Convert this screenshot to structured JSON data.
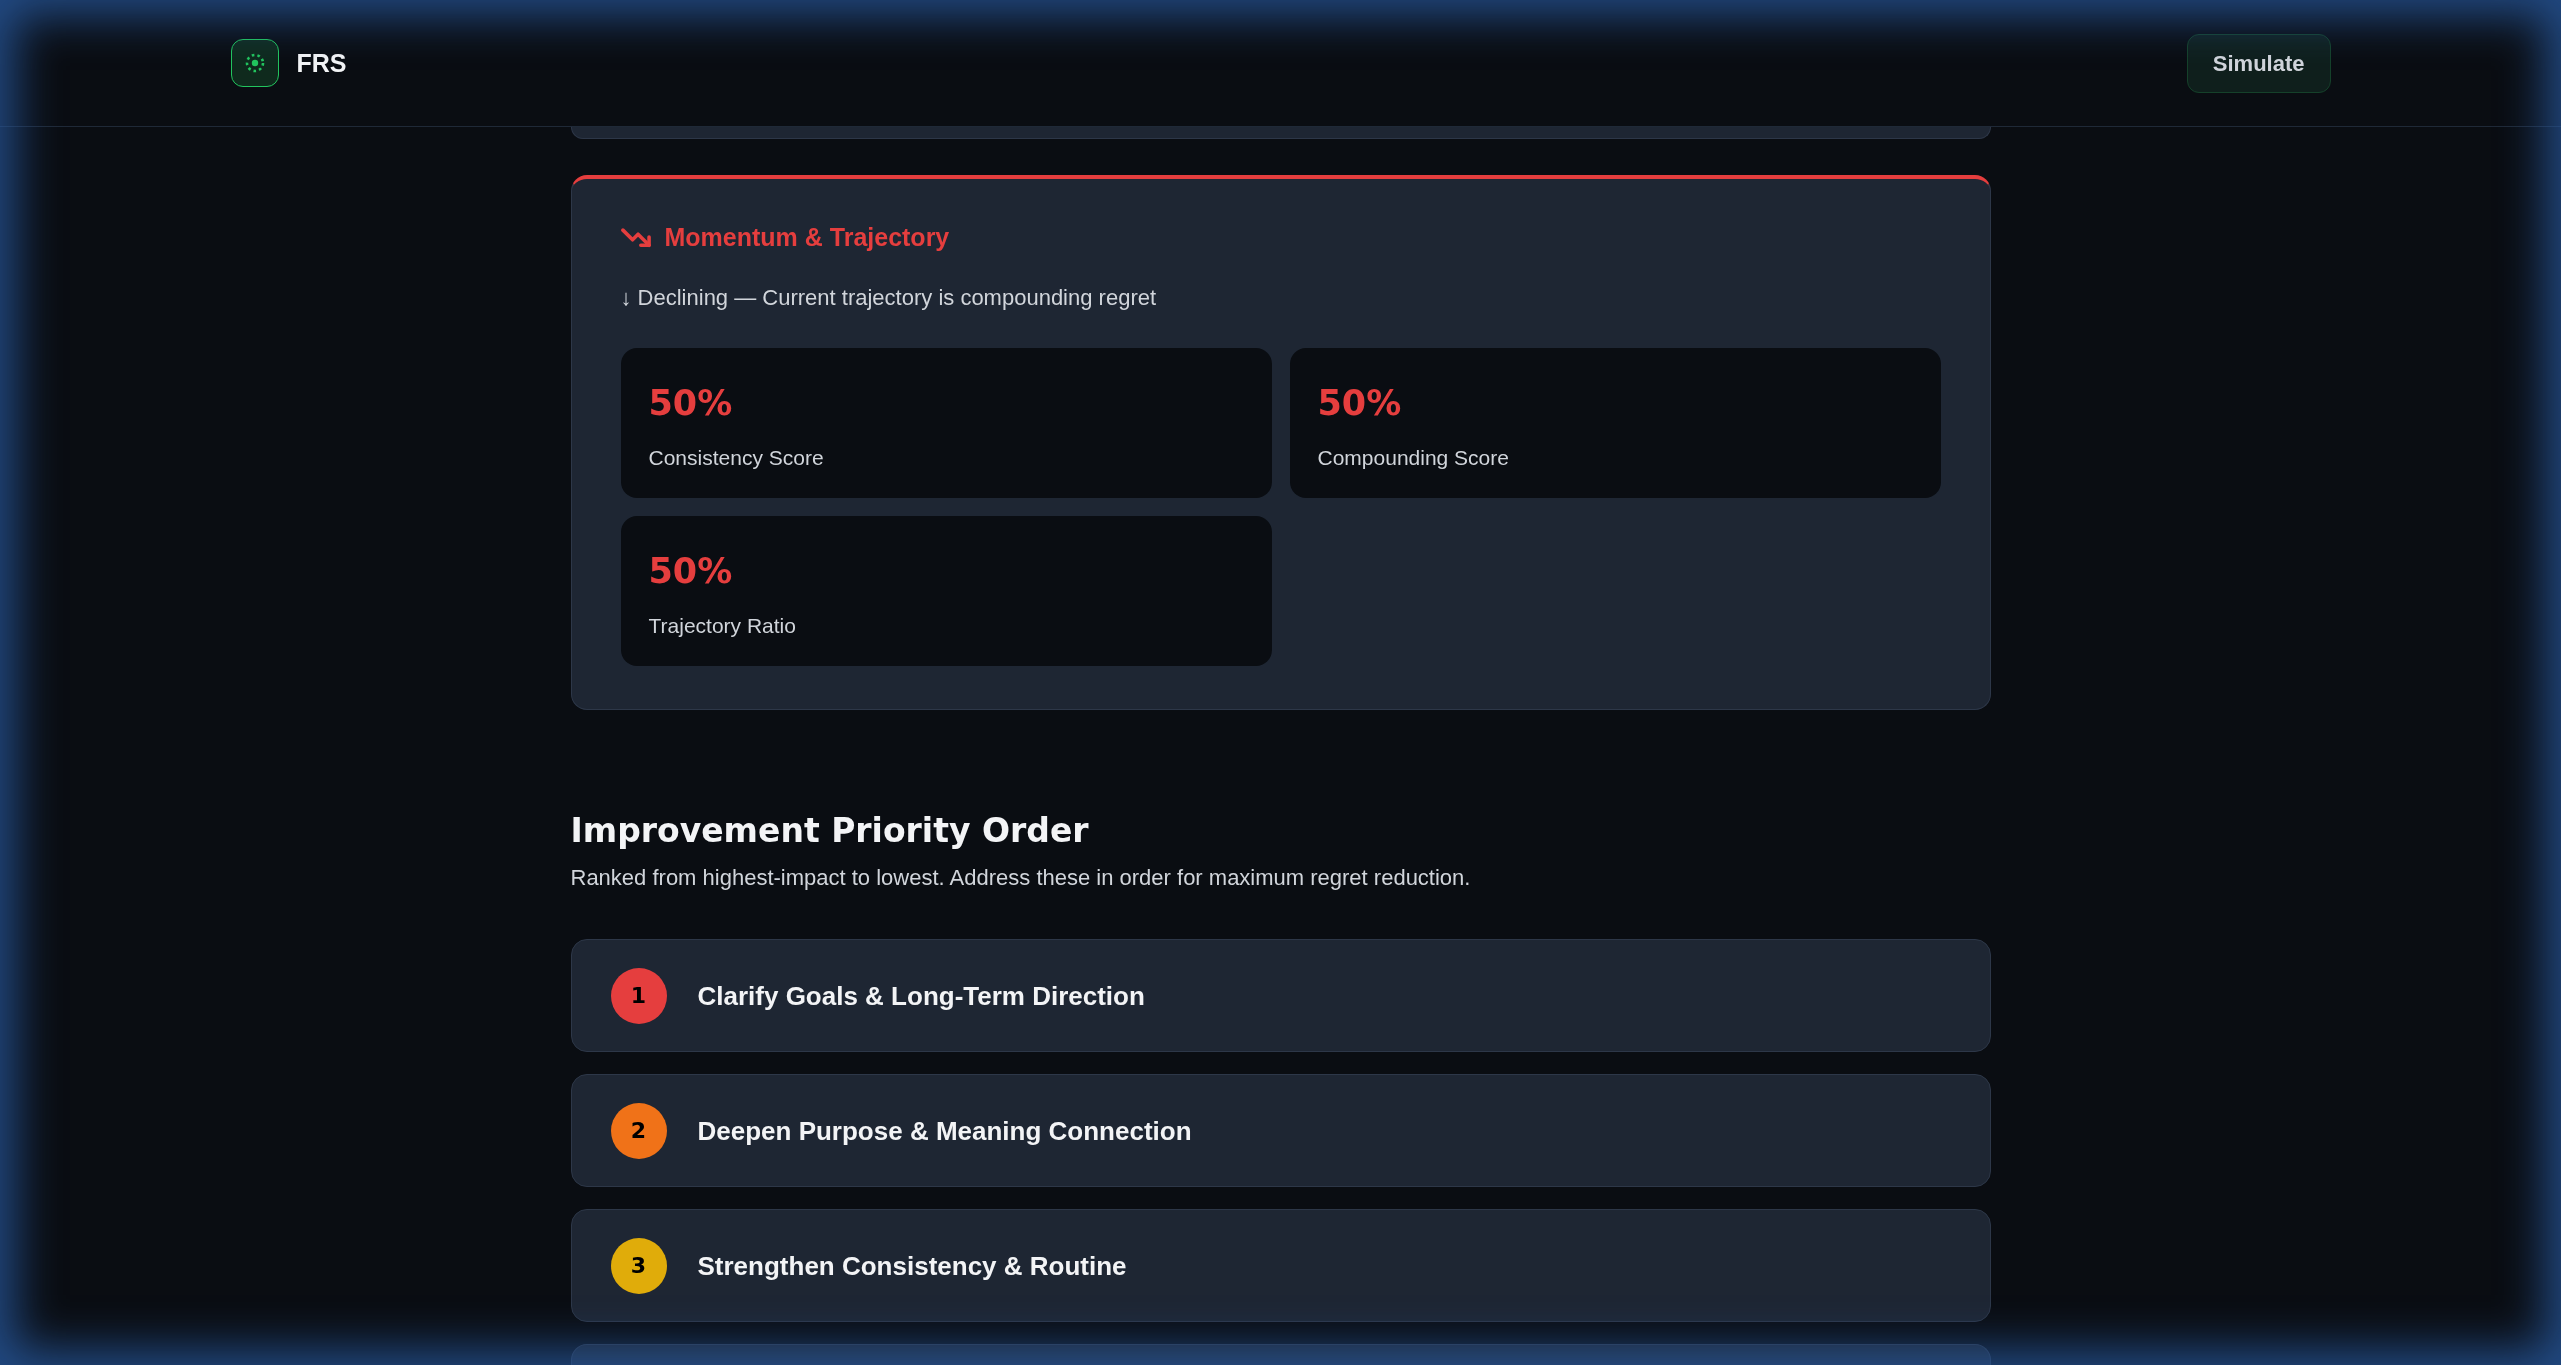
{
  "header": {
    "app_name": "FRS",
    "button": "Simulate"
  },
  "partial_cards": {
    "above": true,
    "below": true
  },
  "momentum": {
    "title": "Momentum & Trajectory",
    "declining": true,
    "summary": "↓ Declining — Current trajectory is compounding regret",
    "metrics": [
      {
        "value": "50%",
        "label": "Consistency Score"
      },
      {
        "value": "50%",
        "label": "Compounding Score"
      },
      {
        "value": "50%",
        "label": "Trajectory Ratio"
      }
    ]
  },
  "priorities": {
    "title": "Improvement Priority Order",
    "subtitle": "Ranked from highest-impact to lowest. Address these in order for maximum regret reduction.",
    "items": [
      {
        "rank": "1",
        "title": "Clarify Goals & Long-Term Direction",
        "color": "#e53e3e"
      },
      {
        "rank": "2",
        "title": "Deepen Purpose & Meaning Connection",
        "color": "#f07218"
      },
      {
        "rank": "3",
        "title": "Strengthen Consistency & Routine",
        "color": "#e0ac0a"
      }
    ]
  }
}
